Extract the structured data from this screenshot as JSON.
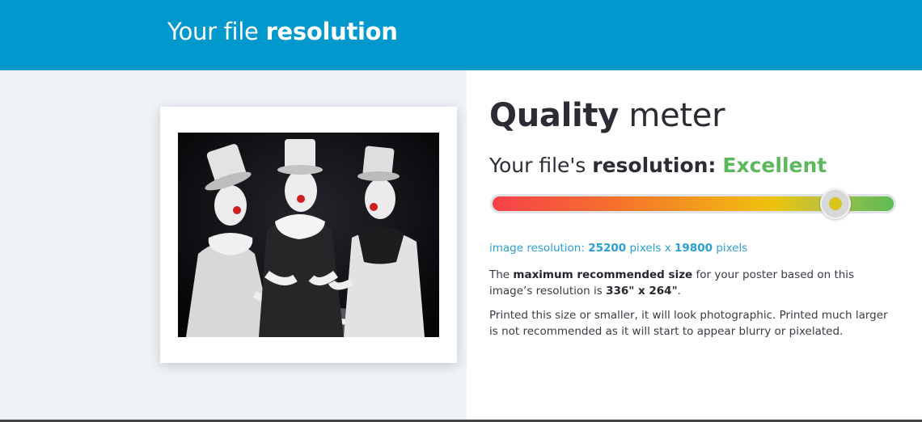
{
  "header": {
    "title_prefix": "Your file ",
    "title_strong": "resolution"
  },
  "poster": {
    "image_alt": "Three clowns in top hats playing poker"
  },
  "quality": {
    "title_strong": "Quality",
    "title_rest": " meter",
    "resolution_prefix": "Your file's ",
    "resolution_strong": "resolution:",
    "rating": "Excellent",
    "rating_color": "#5cb85c",
    "meter_level": 0.85
  },
  "details": {
    "res_prefix": "image resolution: ",
    "res_width": "25200",
    "res_mid": " pixels x ",
    "res_height": "19800",
    "res_suffix": " pixels",
    "p1_a": "The ",
    "p1_strong": "maximum recommended size",
    "p1_b": " for your poster based on this image’s resolution is ",
    "p1_size": "336\" x 264\"",
    "p1_c": ".",
    "p2": "Printed this size or smaller, it will look photographic. Printed much larger is not recommended as it will start to appear blurry or pixelated."
  }
}
